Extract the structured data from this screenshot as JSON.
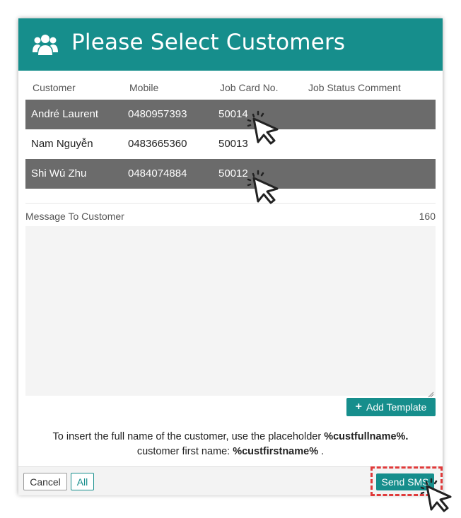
{
  "dialog": {
    "title": "Please Select Customers",
    "header_icon": "users-group-icon",
    "accent_color": "#168e8c"
  },
  "table": {
    "columns": [
      "Customer",
      "Mobile",
      "Job Card No.",
      "Job Status Comment"
    ],
    "rows": [
      {
        "customer": "André Laurent",
        "mobile": "0480957393",
        "job_card": "50014",
        "comment": "",
        "selected": true
      },
      {
        "customer": "Nam Nguyễn",
        "mobile": "0483665360",
        "job_card": "50013",
        "comment": "",
        "selected": false
      },
      {
        "customer": "Shi Wú Zhu",
        "mobile": "0484074884",
        "job_card": "50012",
        "comment": "",
        "selected": true
      }
    ]
  },
  "message": {
    "label": "Message To Customer",
    "char_count": "160",
    "value": ""
  },
  "add_template_label": "Add Template",
  "help": {
    "line1_prefix": "To insert the full name of the customer, use the placeholder",
    "line1_placeholder": "%custfullname%.",
    "line2_prefix": "customer first name:",
    "line2_placeholder": "%custfirstname%",
    "line2_suffix": "."
  },
  "footer": {
    "cancel_label": "Cancel",
    "all_label": "All",
    "send_label": "Send SMS"
  }
}
